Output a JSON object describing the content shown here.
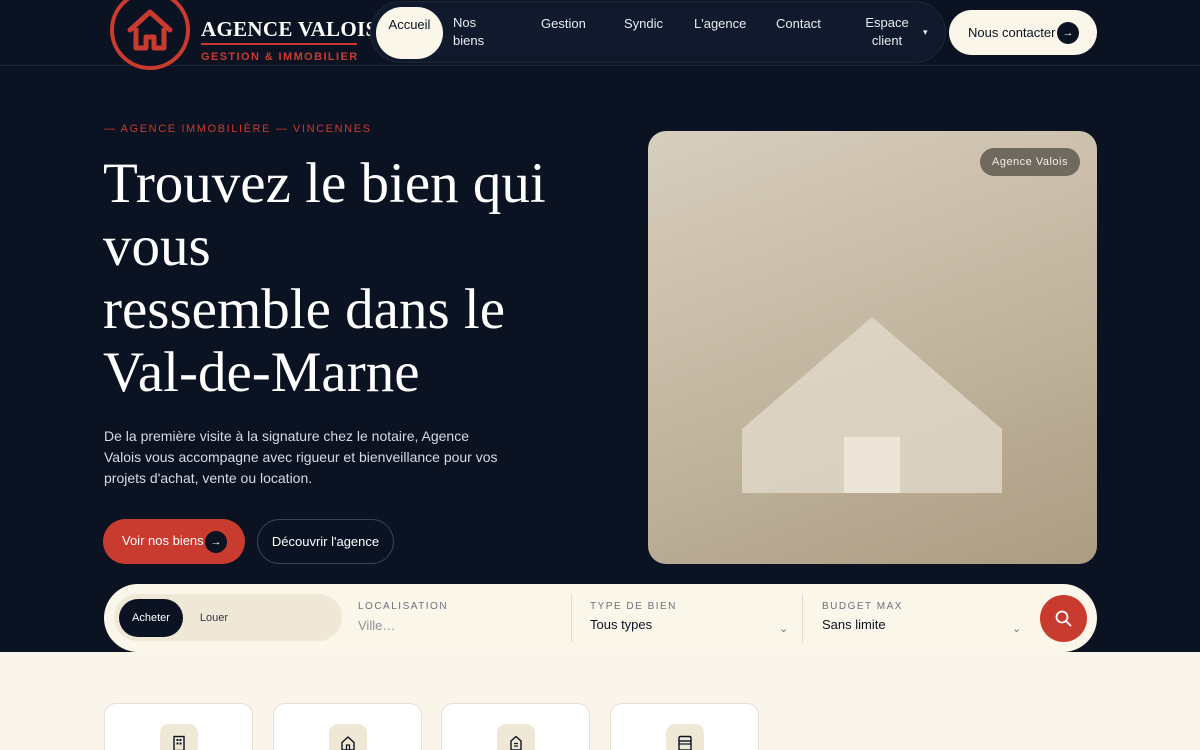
{
  "brand": {
    "name": "AGENCE VALOIS",
    "tagline": "GESTION & IMMOBILIER"
  },
  "nav": {
    "items": [
      {
        "label": "Accueil",
        "active": true
      },
      {
        "label": "Nos\nbiens",
        "active": false
      },
      {
        "label": "Gestion",
        "active": false
      },
      {
        "label": "Syndic",
        "active": false
      },
      {
        "label": "L'agence",
        "active": false
      },
      {
        "label": "Contact",
        "active": false
      },
      {
        "label": "Espace\nclient",
        "active": false
      }
    ],
    "caret": "▾",
    "contact_label": "Nous contacter",
    "contact_arrow": "→"
  },
  "hero": {
    "eyebrow": "— AGENCE IMMOBILIÈRE — VINCENNES",
    "title_lines": [
      "Trouvez le bien qui",
      "vous",
      "ressemble dans le",
      "Val-de-Marne"
    ],
    "description": "De la première visite à la signature chez le notaire, Agence Valois vous accompagne avec rigueur et bienveillance pour vos projets d'achat, vente ou location.",
    "primary_label": "Voir nos biens",
    "primary_arrow": "→",
    "secondary_label": "Découvrir l'agence",
    "card_badge": "Agence Valois"
  },
  "search": {
    "modes": [
      "Acheter",
      "Louer"
    ],
    "active_mode": "Acheter",
    "location_label": "LOCALISATION",
    "location_placeholder": "Ville…",
    "type_label": "TYPE DE BIEN",
    "type_value": "Tous types",
    "budget_label": "BUDGET MAX",
    "budget_value": "Sans limite",
    "chevron": "⌄"
  },
  "categories": {
    "icons": [
      "building-icon",
      "house-icon",
      "townhouse-icon",
      "storefront-icon"
    ]
  },
  "colors": {
    "accent": "#c93b2f",
    "navy": "#0b1222",
    "cream": "#faf6ea"
  }
}
